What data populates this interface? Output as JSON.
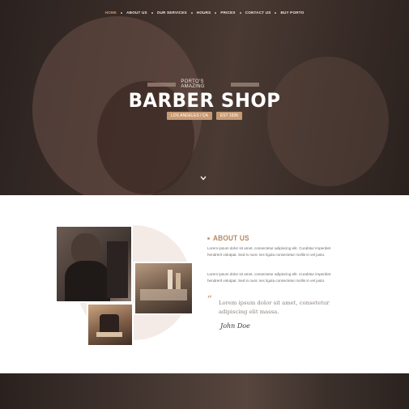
{
  "nav": {
    "items": [
      {
        "label": "HOME",
        "active": true
      },
      {
        "label": "ABOUT US",
        "active": false
      },
      {
        "label": "OUR SERVICES",
        "active": false
      },
      {
        "label": "HOURS",
        "active": false
      },
      {
        "label": "PRICES",
        "active": false
      },
      {
        "label": "CONTACT US",
        "active": false
      },
      {
        "label": "BUY PORTO",
        "active": false
      }
    ]
  },
  "hero": {
    "kicker": "PORTO'S AMAZING",
    "title": "BARBER SHOP",
    "tags": [
      "LOS ANGELES / CA",
      "EST 1936"
    ]
  },
  "about": {
    "heading": "ABOUT US",
    "paragraph1": "Lorem ipsum dolor sit amet, consectetur adipiscing elit. Curabitur imperdiet hendrerit volutpat. Sed in nunc nec ligula consectetur mollis in vel justo.",
    "paragraph2": "Lorem ipsum dolor sit amet, consectetur adipiscing elit. Curabitur imperdiet hendrerit volutpat. Sed in nunc nec ligula consectetur mollis in vel justo.",
    "quote": "Lorem ipsum dolor sit amet, consetetur adipiscing elit massa.",
    "signature": "John Doe"
  },
  "colors": {
    "accent": "#c79a74",
    "dark": "#2a2220"
  }
}
